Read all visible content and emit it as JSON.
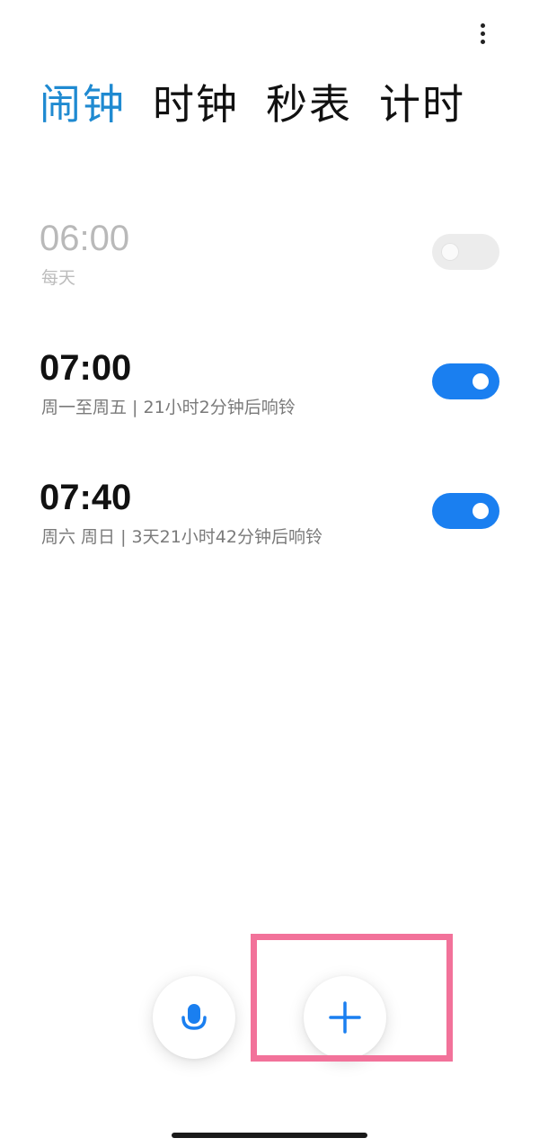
{
  "header": {
    "more_icon": "more-vertical-icon"
  },
  "tabs": [
    {
      "label": "闹钟",
      "active": true
    },
    {
      "label": "时钟",
      "active": false
    },
    {
      "label": "秒表",
      "active": false
    },
    {
      "label": "计时",
      "active": false
    }
  ],
  "alarms": [
    {
      "time": "06:00",
      "subtitle": "每天",
      "enabled": false
    },
    {
      "time": "07:00",
      "subtitle": "周一至周五 | 21小时2分钟后响铃",
      "enabled": true
    },
    {
      "time": "07:40",
      "subtitle": "周六 周日 | 3天21小时42分钟后响铃",
      "enabled": true
    }
  ],
  "actions": {
    "voice_icon": "microphone-icon",
    "add_icon": "plus-icon"
  },
  "colors": {
    "accent": "#1f8ad1",
    "toggle_on": "#1a7ff0",
    "highlight": "#f2729a"
  }
}
